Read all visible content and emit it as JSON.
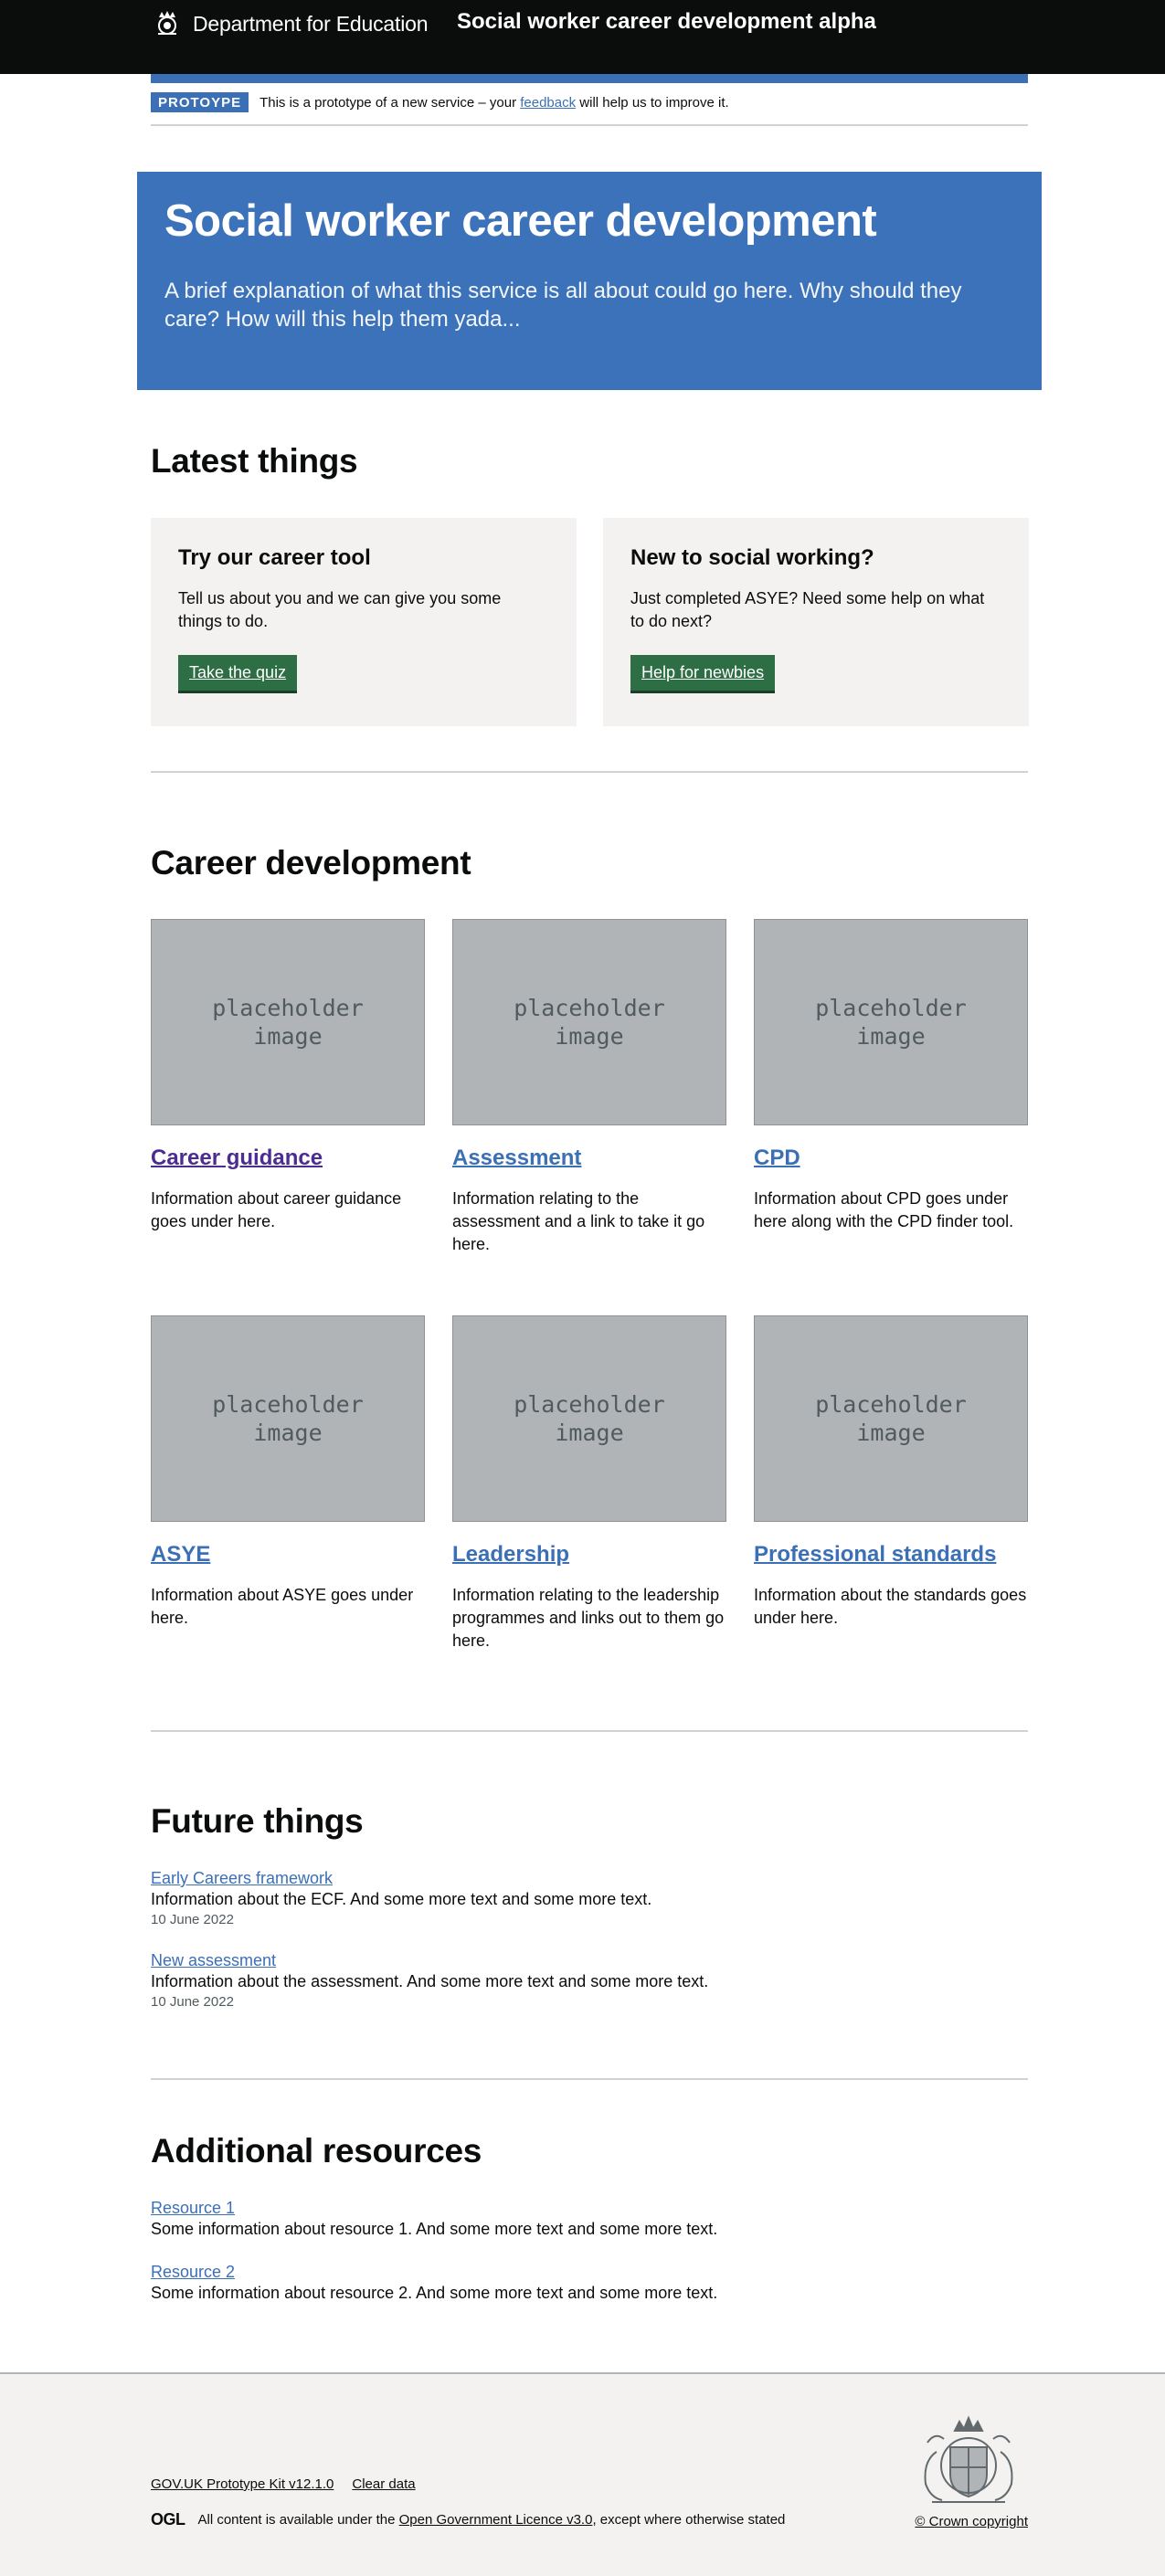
{
  "header": {
    "org_name": "Department for Education",
    "service_name": "Social worker career development alpha",
    "crest_icon": "crown-crest-icon"
  },
  "phase_banner": {
    "tag": "PROTOYPE",
    "text_before": "This is a prototype of a new service – your ",
    "link": "feedback",
    "text_after": " will help us to improve it."
  },
  "hero": {
    "title": "Social worker career development",
    "description": "A brief explanation of what this service is all about could go here. Why should they care? How will this help them yada..."
  },
  "latest": {
    "heading": "Latest things",
    "cards": [
      {
        "title": "Try our career tool",
        "body": "Tell us about you and we can give you some things to do.",
        "button": "Take the quiz"
      },
      {
        "title": "New to social working?",
        "body": "Just completed ASYE? Need some help on what to do next?",
        "button": "Help for newbies"
      }
    ]
  },
  "career": {
    "heading": "Career development",
    "placeholder_line1": "placeholder",
    "placeholder_line2": "image",
    "tiles": [
      {
        "title": "Career guidance",
        "body": "Information about career guidance goes under here."
      },
      {
        "title": "Assessment",
        "body": "Information relating to the assessment and a link to take it go here."
      },
      {
        "title": "CPD",
        "body": "Information about CPD goes under here along with the CPD finder tool."
      },
      {
        "title": "ASYE",
        "body": "Information about ASYE goes under here."
      },
      {
        "title": "Leadership",
        "body": "Information relating to the leadership programmes and links out to them go here."
      },
      {
        "title": "Professional standards",
        "body": "Information about the standards goes under here."
      }
    ]
  },
  "future": {
    "heading": "Future things",
    "items": [
      {
        "link": "Early Careers framework",
        "desc": "Information about the ECF. And some more text and some more text.",
        "date": "10 June 2022"
      },
      {
        "link": "New assessment",
        "desc": "Information about the assessment. And some more text and some more text.",
        "date": "10 June 2022"
      }
    ]
  },
  "resources": {
    "heading": "Additional resources",
    "items": [
      {
        "link": "Resource 1",
        "desc": "Some information about resource 1. And some more text and some more text."
      },
      {
        "link": "Resource 2",
        "desc": "Some information about resource 2. And some more text and some more text."
      }
    ]
  },
  "footer": {
    "links": [
      "GOV.UK Prototype Kit v12.1.0",
      "Clear data"
    ],
    "ogl": "OGL",
    "licence_before": "All content is available under the ",
    "licence_link": "Open Government Licence v3.0",
    "licence_after": ", except where otherwise stated",
    "copyright": "© Crown copyright",
    "crest_icon": "royal-coat-of-arms-icon"
  }
}
